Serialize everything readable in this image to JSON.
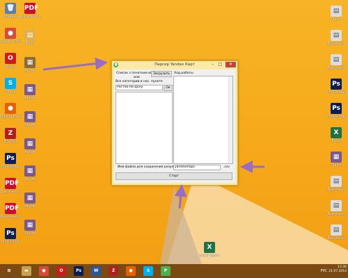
{
  "window": {
    "title": "Парсер Yandex Карт",
    "min_glyph": "–",
    "max_glyph": "□",
    "close_glyph": "✕"
  },
  "form": {
    "cities_label": "Список з початком во",
    "cities_label2": "или",
    "load_button": "Загрузить",
    "all_categories_label": "Все категории в нас. пункте",
    "city_value": "Ростов-На-Дону",
    "ok_button": "Ок",
    "log_label": "Ход работы",
    "filename_label": "Имя файла для сохранения результатов:",
    "filename_value": "yandexmaps",
    "extension": ".csv",
    "start_button": "Старт"
  },
  "desktop_icons": [
    {
      "label": "Корзина",
      "glyph": "🗑",
      "color": "#5b7fa8"
    },
    {
      "label": "Google Chrome",
      "glyph": "●",
      "color": "#d94a38"
    },
    {
      "label": "Opera",
      "glyph": "O",
      "color": "#cc1b1b"
    },
    {
      "label": "Skype",
      "glyph": "S",
      "color": "#00aff0"
    },
    {
      "label": "Mozilla Firefox",
      "glyph": "●",
      "color": "#e66000"
    },
    {
      "label": "FileZilla",
      "glyph": "Z",
      "color": "#b0201d"
    },
    {
      "label": "Photoshop",
      "glyph": "Ps",
      "color": "#0b1e4d"
    },
    {
      "label": "Документ.pdf",
      "glyph": "PDF",
      "color": "#c8102e"
    },
    {
      "label": "Документ.pdf",
      "glyph": "PDF",
      "color": "#c8102e"
    },
    {
      "label": "Photoshop",
      "glyph": "Ps",
      "color": "#0b1e4d"
    }
  ],
  "desktop_icons_col2": [
    {
      "label": "Документ.pdf",
      "glyph": "PDF",
      "color": "#c8102e"
    },
    {
      "label": "Файл",
      "glyph": "▤",
      "color": "#e0b050"
    },
    {
      "label": "Архив",
      "glyph": "▦",
      "color": "#8a6d3b"
    },
    {
      "label": "Архив",
      "glyph": "▦",
      "color": "#7a5a8a"
    },
    {
      "label": "Архив",
      "glyph": "▦",
      "color": "#7a5a8a"
    },
    {
      "label": "Архив",
      "glyph": "▦",
      "color": "#7a5a8a"
    },
    {
      "label": "Архив",
      "glyph": "▦",
      "color": "#7a5a8a"
    },
    {
      "label": "Архив",
      "glyph": "▦",
      "color": "#7a5a8a"
    },
    {
      "label": "Архив",
      "glyph": "▦",
      "color": "#7a5a8a"
    }
  ],
  "desktop_icons_right": [
    {
      "label": "Файл",
      "glyph": "▤",
      "color": "#dddddd"
    },
    {
      "label": "Документ",
      "glyph": "▤",
      "color": "#dddddd"
    },
    {
      "label": "Документ",
      "glyph": "▤",
      "color": "#dddddd"
    },
    {
      "label": "Photoshop",
      "glyph": "Ps",
      "color": "#0b1e4d"
    },
    {
      "label": "Photoshop",
      "glyph": "Ps",
      "color": "#0b1e4d"
    },
    {
      "label": "Excel",
      "glyph": "X",
      "color": "#1f7244"
    },
    {
      "label": "Файл",
      "glyph": "▦",
      "color": "#7a5a8a"
    },
    {
      "label": "Документ",
      "glyph": "▤",
      "color": "#dddddd"
    },
    {
      "label": "Документ",
      "glyph": "▤",
      "color": "#dddddd"
    },
    {
      "label": "Документ",
      "glyph": "▤",
      "color": "#dddddd"
    }
  ],
  "center_icon": {
    "label": "Excel файл",
    "glyph": "X",
    "color": "#1f7244"
  },
  "taskbar": {
    "buttons": [
      {
        "glyph": "⊞",
        "color": "#7a4a12"
      },
      {
        "glyph": "▬",
        "color": "#c8a050"
      },
      {
        "glyph": "●",
        "color": "#d94a38"
      },
      {
        "glyph": "O",
        "color": "#cc1b1b"
      },
      {
        "glyph": "Ps",
        "color": "#0b1e4d"
      },
      {
        "glyph": "W",
        "color": "#2b579a"
      },
      {
        "glyph": "Z",
        "color": "#b0201d"
      },
      {
        "glyph": "●",
        "color": "#e66000"
      },
      {
        "glyph": "S",
        "color": "#00aff0"
      },
      {
        "glyph": "P",
        "color": "#4caf50"
      }
    ],
    "lang": "РУС",
    "time": "13:30",
    "date": "21.07.2014"
  }
}
